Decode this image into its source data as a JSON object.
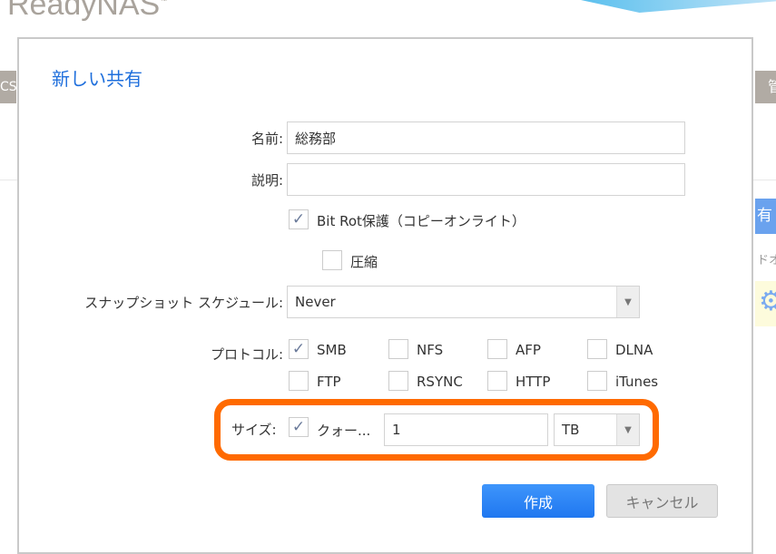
{
  "background": {
    "logo": "ReadyNAS",
    "logo_tm": "™",
    "left_tab": "CS",
    "right_tab": "管",
    "right_button": "有",
    "right_text": "ドオ"
  },
  "dialog": {
    "title": "新しい共有",
    "name": {
      "label": "名前:",
      "value": "総務部"
    },
    "description": {
      "label": "説明:",
      "value": ""
    },
    "bitrot": {
      "label": "Bit Rot保護（コピーオンライト）",
      "checked": true
    },
    "compress": {
      "label": "圧縮",
      "checked": false
    },
    "snapshot": {
      "label": "スナップショット スケジュール:",
      "value": "Never"
    },
    "protocols": {
      "label": "プロトコル:",
      "items": [
        {
          "label": "SMB",
          "checked": true
        },
        {
          "label": "NFS",
          "checked": false
        },
        {
          "label": "AFP",
          "checked": false
        },
        {
          "label": "DLNA",
          "checked": false
        },
        {
          "label": "FTP",
          "checked": false
        },
        {
          "label": "RSYNC",
          "checked": false
        },
        {
          "label": "HTTP",
          "checked": false
        },
        {
          "label": "iTunes",
          "checked": false
        }
      ]
    },
    "size": {
      "label": "サイズ:",
      "quota_label": "クォー...",
      "checked": true,
      "value": "1",
      "unit": "TB"
    },
    "create_label": "作成",
    "cancel_label": "キャンセル",
    "check_mark": "✓",
    "arrow": "⌄"
  },
  "colors": {
    "accent": "#1f77f0",
    "highlight": "#ff6a00"
  }
}
